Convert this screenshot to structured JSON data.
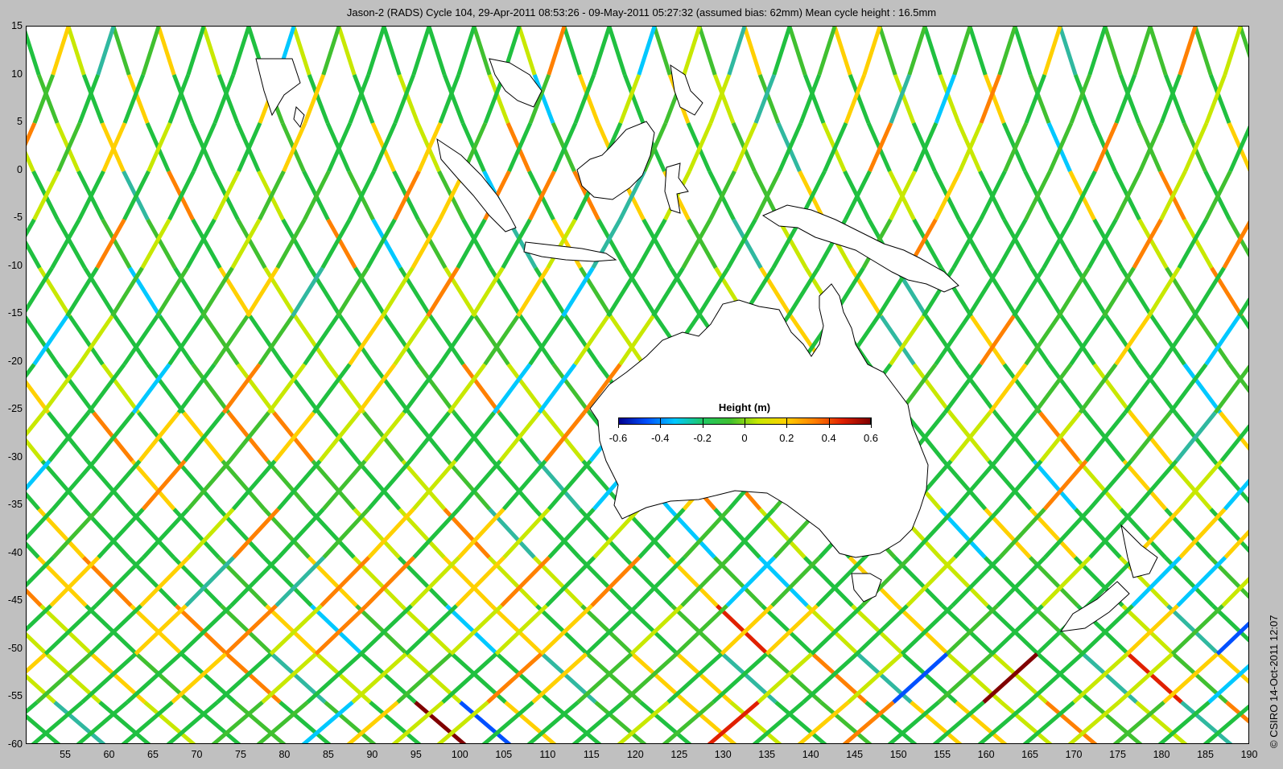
{
  "title": "Jason-2 (RADS) Cycle 104, 29-Apr-2011 08:53:26 - 09-May-2011 05:27:32 (assumed bias: 62mm)  Mean cycle height : 16.5mm",
  "credit": "© CSIRO 14-Oct-2011 12:07",
  "axes": {
    "lon_range": [
      50.5,
      190
    ],
    "lat_range": [
      -60,
      15
    ],
    "lon_ticks": [
      "55",
      "60",
      "65",
      "70",
      "75",
      "80",
      "85",
      "90",
      "95",
      "100",
      "105",
      "110",
      "115",
      "120",
      "125",
      "130",
      "135",
      "140",
      "145",
      "150",
      "155",
      "160",
      "165",
      "170",
      "175",
      "180",
      "185",
      "190"
    ],
    "lat_ticks": [
      "15",
      "10",
      "5",
      "0",
      "-5",
      "-10",
      "-15",
      "-20",
      "-25",
      "-30",
      "-35",
      "-40",
      "-45",
      "-50",
      "-55",
      "-60"
    ]
  },
  "legend": {
    "title": "Height (m)",
    "range": [
      -0.6,
      0.6
    ],
    "ticks": [
      "-0.6",
      "-0.4",
      "-0.2",
      "0",
      "0.2",
      "0.4",
      "0.6"
    ],
    "colormap": [
      "#00008f",
      "#0050ff",
      "#00c8ff",
      "#20c864",
      "#40c030",
      "#c8e800",
      "#ffd000",
      "#ff8000",
      "#e02000",
      "#800000"
    ]
  },
  "colors": {
    "land": "#ffffff",
    "coast": "#000000",
    "track_dominant": "#20c040",
    "background": "#c0c0c0"
  }
}
